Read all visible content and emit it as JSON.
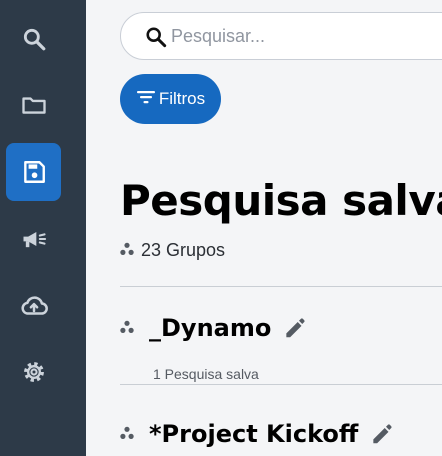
{
  "search": {
    "placeholder": "Pesquisar..."
  },
  "filters": {
    "label": "Filtros"
  },
  "page": {
    "title": "Pesquisa salva",
    "group_count": "23 Grupos"
  },
  "groups": [
    {
      "name": "_Dynamo",
      "subtitle": "1 Pesquisa salva"
    },
    {
      "name": "*Project Kickoff"
    }
  ],
  "sidebar": {
    "items": [
      {
        "icon": "search-icon"
      },
      {
        "icon": "folder-icon"
      },
      {
        "icon": "save-icon",
        "active": true
      },
      {
        "icon": "megaphone-icon"
      },
      {
        "icon": "cloud-upload-icon"
      },
      {
        "icon": "gear-icon"
      }
    ]
  },
  "colors": {
    "sidebar_bg": "#2d3a48",
    "accent": "#1669c0",
    "active_nav": "#1f6fc5",
    "page_bg": "#f4f5f7"
  }
}
